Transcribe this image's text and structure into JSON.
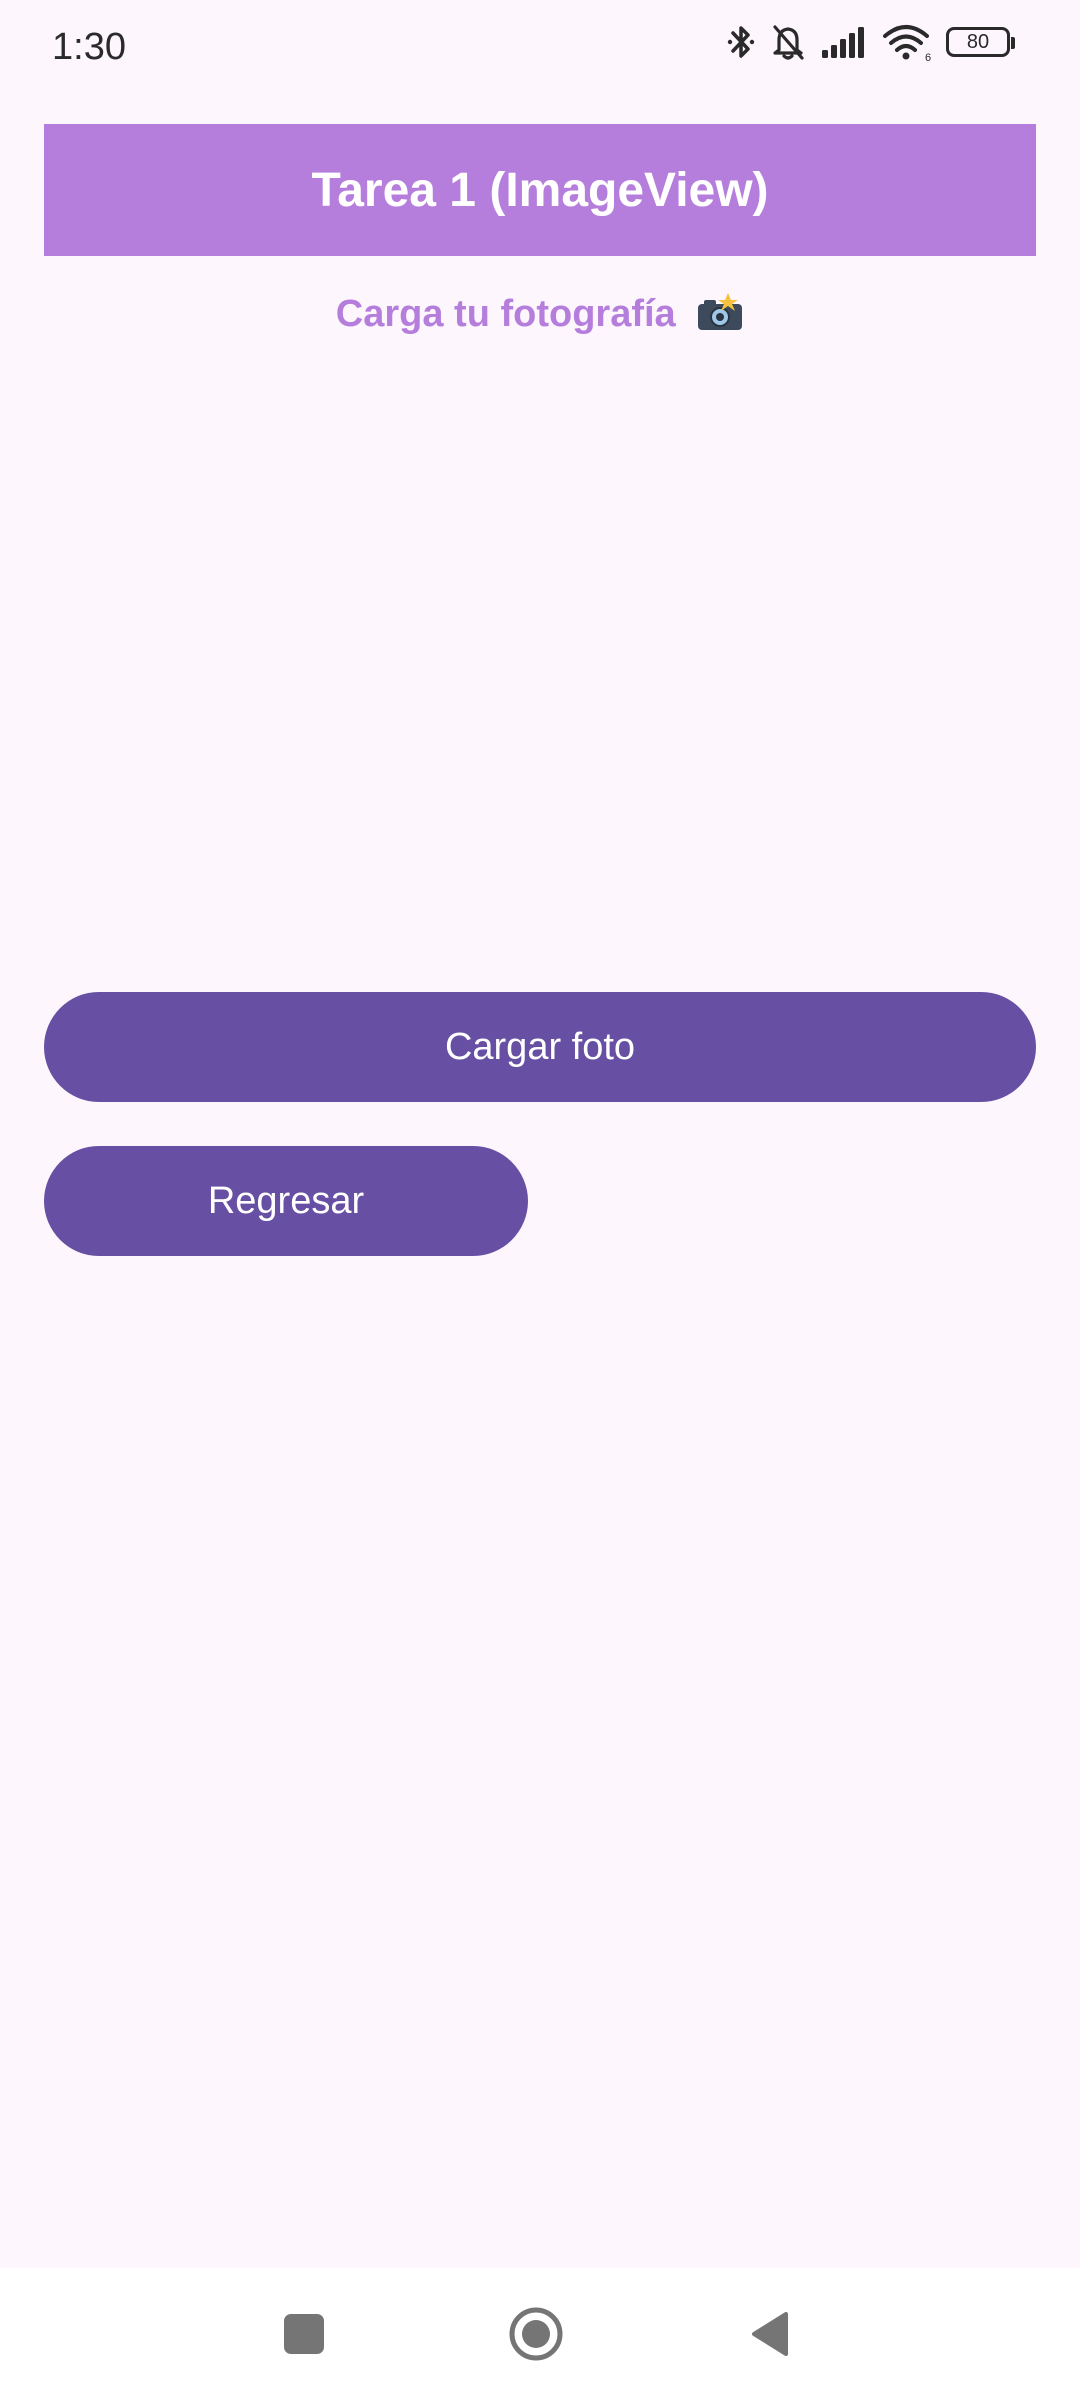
{
  "status_bar": {
    "time": "1:30",
    "battery_level": "80",
    "icons": [
      "bluetooth-icon",
      "bell-off-icon",
      "signal-icon",
      "wifi-icon",
      "battery-icon"
    ]
  },
  "header": {
    "title": "Tarea 1 (ImageView)"
  },
  "main": {
    "subtitle": "Carga tu fotografía",
    "subtitle_icon": "camera-flash-icon",
    "load_button_label": "Cargar foto",
    "back_button_label": "Regresar"
  },
  "nav_bar": {
    "icons": [
      "recents-square-icon",
      "home-circle-icon",
      "back-triangle-icon"
    ]
  },
  "colors": {
    "background": "#fdf6fd",
    "header_bg": "#b57edc",
    "subtitle": "#b57edc",
    "button_bg": "#6750a4",
    "button_text": "#ffffff"
  }
}
